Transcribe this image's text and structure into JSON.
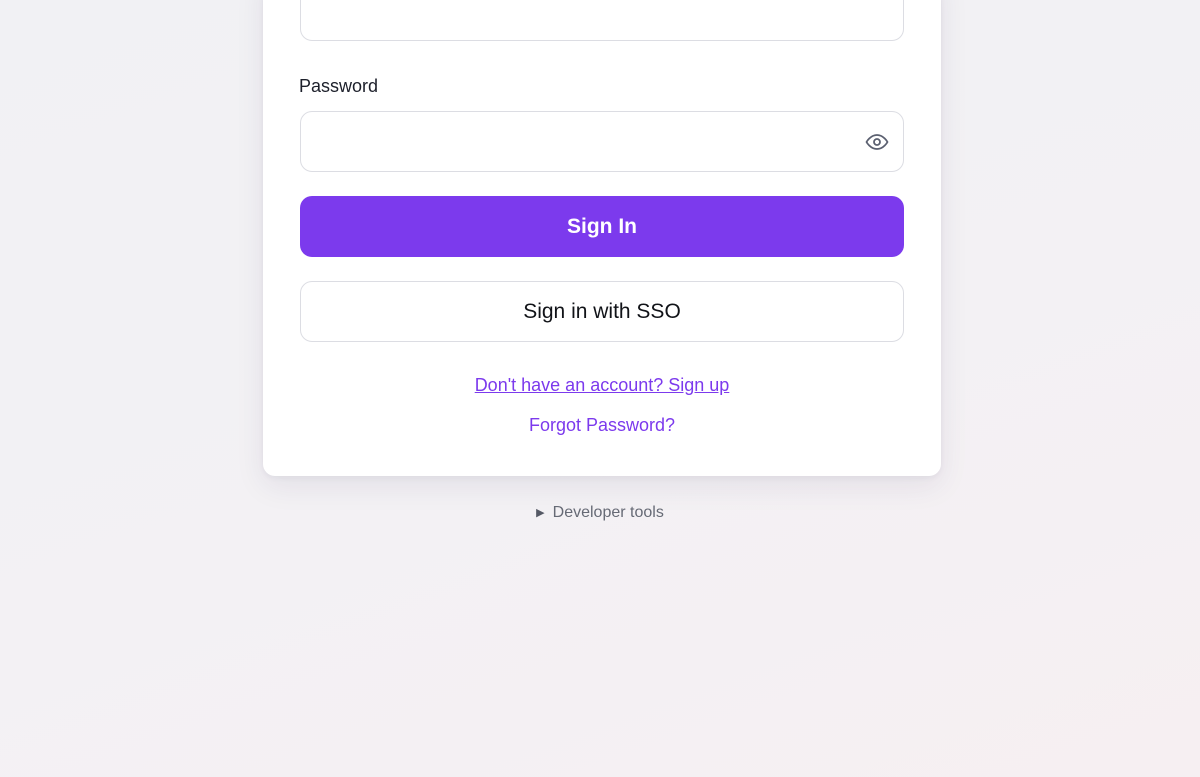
{
  "login_form": {
    "email": {
      "value": "",
      "placeholder": ""
    },
    "password": {
      "label": "Password",
      "value": "",
      "placeholder": "",
      "toggle_icon": "eye-icon"
    },
    "sign_in_label": "Sign In",
    "sso_label": "Sign in with SSO",
    "signup_link": "Don't have an account? Sign up",
    "forgot_link": "Forgot Password?"
  },
  "developer_tools": {
    "label": "Developer tools",
    "expand_icon": "triangle-right-icon"
  },
  "colors": {
    "accent": "#7c3aed",
    "card_background": "#ffffff",
    "input_border": "#dcdde3"
  }
}
